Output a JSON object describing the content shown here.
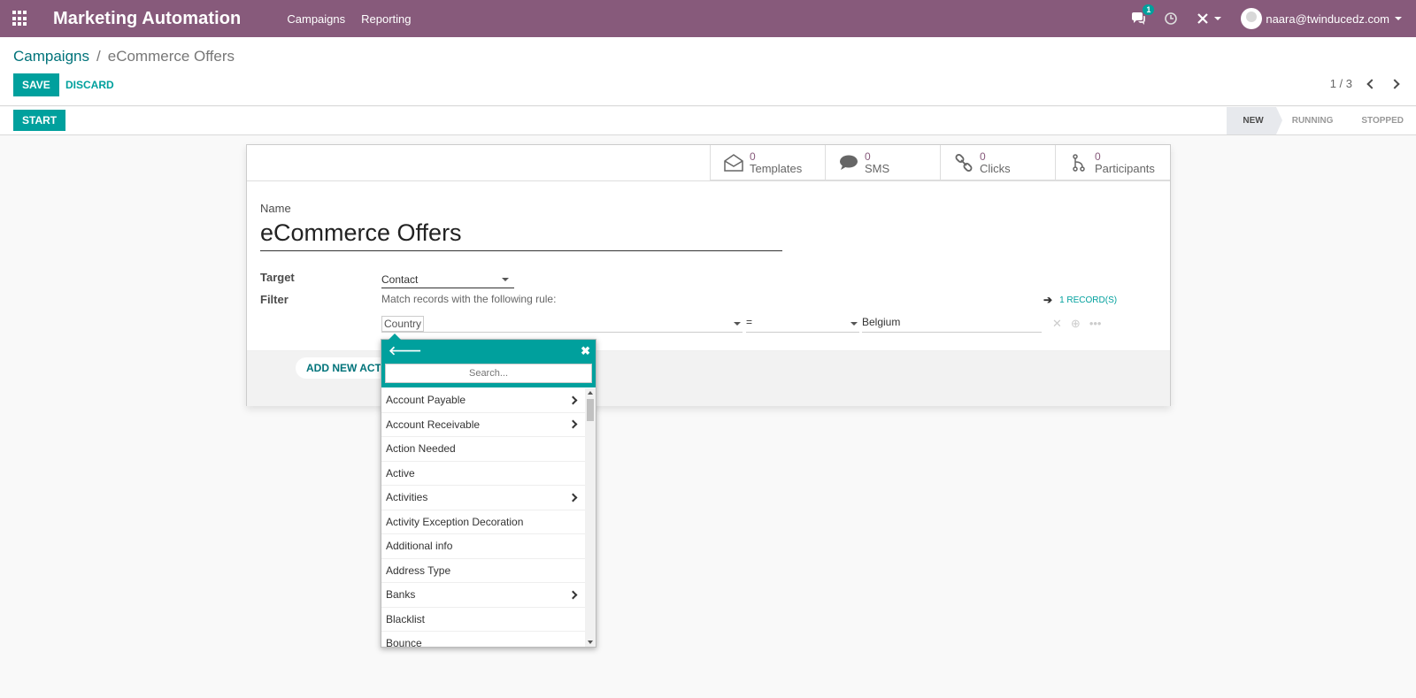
{
  "navbar": {
    "app_title": "Marketing Automation",
    "menu": [
      "Campaigns",
      "Reporting"
    ],
    "message_count": "1",
    "user_email": "naara@twinducedz.com",
    "bg_color": "#875a7b"
  },
  "breadcrumb": {
    "parent": "Campaigns",
    "separator": "/",
    "current": "eCommerce Offers"
  },
  "actions": {
    "save": "SAVE",
    "discard": "DISCARD",
    "start": "START"
  },
  "pager": {
    "value": "1 / 3"
  },
  "stages": [
    "NEW",
    "RUNNING",
    "STOPPED"
  ],
  "active_stage": "NEW",
  "stat_buttons": [
    {
      "count": "0",
      "label": "Templates",
      "icon": "envelope-open-icon"
    },
    {
      "count": "0",
      "label": "SMS",
      "icon": "comment-icon"
    },
    {
      "count": "0",
      "label": "Clicks",
      "icon": "link-icon"
    },
    {
      "count": "0",
      "label": "Participants",
      "icon": "code-fork-icon"
    }
  ],
  "form": {
    "name_label": "Name",
    "name_value": "eCommerce Offers",
    "target_label": "Target",
    "target_value": "Contact",
    "filter_label": "Filter",
    "filter_rule": "Match records with the following rule:",
    "records_link": "1 RECORD(S)",
    "domain_field": "Country",
    "domain_operator": "=",
    "domain_value": "Belgium",
    "add_activity": "ADD NEW ACTIVITY"
  },
  "field_selector": {
    "search_placeholder": "Search...",
    "items": [
      {
        "label": "Account Payable",
        "has_children": true
      },
      {
        "label": "Account Receivable",
        "has_children": true
      },
      {
        "label": "Action Needed",
        "has_children": false
      },
      {
        "label": "Active",
        "has_children": false
      },
      {
        "label": "Activities",
        "has_children": true
      },
      {
        "label": "Activity Exception Decoration",
        "has_children": false
      },
      {
        "label": "Additional info",
        "has_children": false
      },
      {
        "label": "Address Type",
        "has_children": false
      },
      {
        "label": "Banks",
        "has_children": true
      },
      {
        "label": "Blacklist",
        "has_children": false
      },
      {
        "label": "Bounce",
        "has_children": false
      }
    ]
  },
  "colors": {
    "primary": "#00a09d",
    "brand": "#875a7b"
  }
}
